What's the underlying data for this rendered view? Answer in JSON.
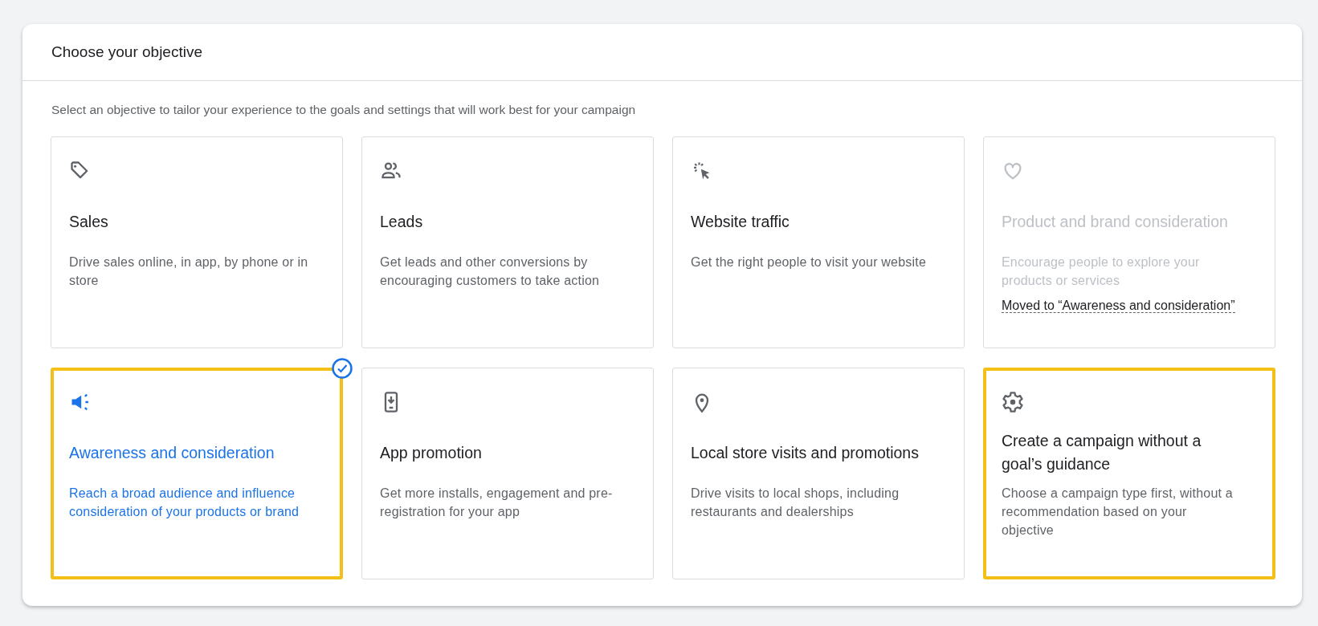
{
  "panel": {
    "title": "Choose your objective",
    "subtitle": "Select an objective to tailor your experience to the goals and settings that will work best for your campaign"
  },
  "objectives": [
    {
      "title": "Sales",
      "description": "Drive sales online, in app, by phone or in store",
      "selected": false,
      "disabled": false,
      "highlighted": false
    },
    {
      "title": "Leads",
      "description": "Get leads and other conversions by encouraging customers to take action",
      "selected": false,
      "disabled": false,
      "highlighted": false
    },
    {
      "title": "Website traffic",
      "description": "Get the right people to visit your website",
      "selected": false,
      "disabled": false,
      "highlighted": false
    },
    {
      "title": "Product and brand consideration",
      "description": "Encourage people to explore your products or services",
      "note": "Moved to “Awareness and consideration”",
      "selected": false,
      "disabled": true,
      "highlighted": false
    },
    {
      "title": "Awareness and consideration",
      "description": "Reach a broad audience and influence consideration of your products or brand",
      "selected": true,
      "disabled": false,
      "highlighted": true
    },
    {
      "title": "App promotion",
      "description": "Get more installs, engagement and pre-registration for your app",
      "selected": false,
      "disabled": false,
      "highlighted": false
    },
    {
      "title": "Local store visits and promotions",
      "description": "Drive visits to local shops, including restaurants and dealerships",
      "selected": false,
      "disabled": false,
      "highlighted": false
    },
    {
      "title": "Create a campaign without a goal’s guidance",
      "description": "Choose a campaign type first, without a recommendation based on your objective",
      "selected": false,
      "disabled": false,
      "highlighted": true
    }
  ]
}
